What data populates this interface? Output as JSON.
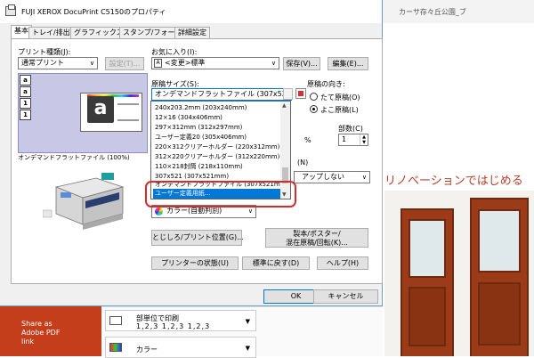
{
  "window": {
    "title": "FUJI XEROX DocuPrint C5150のプロパティ"
  },
  "tabs": [
    {
      "label": "基本",
      "active": true
    },
    {
      "label": "トレイ/排出"
    },
    {
      "label": "グラフィックス"
    },
    {
      "label": "スタンプ/フォーム"
    },
    {
      "label": "詳細設定"
    }
  ],
  "print_type": {
    "label": "プリント種類(J):",
    "value": "通常プリント",
    "settings_button": "設定(T)..."
  },
  "favorites": {
    "label": "お気に入り(I):",
    "value": "<変更>標準",
    "save_button": "保存(V)...",
    "edit_button": "編集(E)..."
  },
  "preview": {
    "icons": [
      "a",
      "a",
      "1",
      "1"
    ],
    "paper_letter": "a",
    "caption": "オンデマンドフラットファイル (100%)"
  },
  "paper_size": {
    "label": "原稿サイズ(S):",
    "value": "オンデマンドフラットファイル (307x521",
    "options": [
      "240x203.2mm (203x240mm)",
      "12×16 (304x406mm)",
      "297×312mm (312x297mm)",
      "ユーザー定義20 (305x406mm)",
      "220×312クリアーホルダー (220x312mm)",
      "312×220クリアーホルダー (312x220mm)",
      "110×218封筒 (218x110mm)",
      "307x521 (307x521mm)",
      "オンデマンドフラットファイル (307x521mm)",
      "ユーザー定義用紙..."
    ],
    "selected_index": 9
  },
  "orientation": {
    "label": "原稿の向き:",
    "portrait": "たて原稿(O)",
    "landscape": "よこ原稿(L)",
    "selected": "landscape"
  },
  "copies": {
    "label": "部数(C)",
    "value": "1"
  },
  "percent_unit": "%",
  "nup": {
    "label_suffix": "(N)",
    "value": "アップしない"
  },
  "color_mode": {
    "value": "カラー(自動判別)"
  },
  "buttons": {
    "binding": "とじしろ/プリント位置(G)...",
    "poster": "製本/ポスター/\n混在原稿/回転(K)...",
    "printer_status": "プリンターの状態(U)",
    "defaults": "標準に戻す(D)",
    "help": "ヘルプ(H)",
    "ok": "OK",
    "cancel": "キャンセル"
  },
  "background": {
    "sidebar_share": "Share as\nAdobe PDF\nlink",
    "topbar_text": "カーサ存々丘公園_ブ",
    "headline": "リノベーションではじめる",
    "collate_label": "部単位で印刷",
    "collate_order": "1,2,3   1,2,3   1,2,3",
    "color_label": "カラー"
  },
  "colors": {
    "accent": "#0078d7",
    "highlight_ring": "#d62b2b",
    "sidebar": "#c43e1c"
  }
}
